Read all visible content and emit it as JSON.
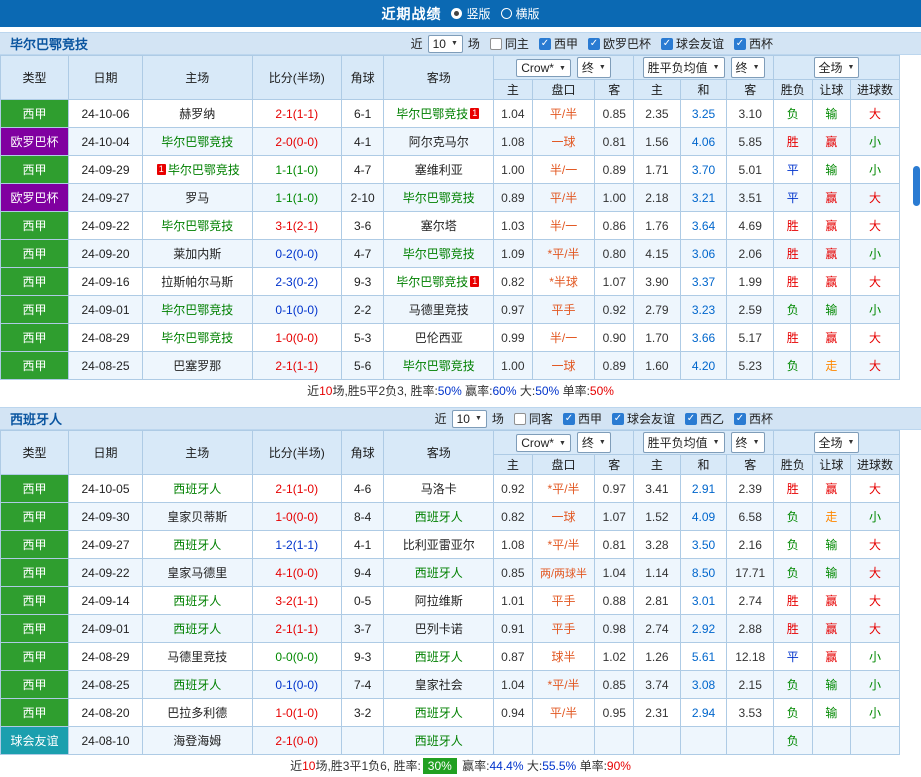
{
  "topbar": {
    "title": "近期战绩",
    "options": [
      {
        "label": "竖版",
        "selected": true
      },
      {
        "label": "横版",
        "selected": false
      }
    ]
  },
  "colors": {
    "topbar_bg": "#0b69b3",
    "section_bg": "#d3e4f4",
    "header_bg": "#d8e9f8",
    "grid_border": "#aecbe5",
    "row_stripe": "#eef6fd",
    "laliga_green": "#2f9e2f",
    "europa_purple": "#8000a0",
    "friendly_teal": "#1b9fae",
    "tracked_team_green": "#008000",
    "home_win_red": "#e60000",
    "draw_blue": "#0033cc",
    "away_win_blue": "#0033cc",
    "lose_green": "#008800",
    "push_orange": "#ff8800",
    "handicap_orange": "#e25822",
    "draw_odds_blue": "#0066cc",
    "summary_badge_green": "#21a021",
    "red_card_badge": "#e80000"
  },
  "table_header": {
    "cols": [
      "类型",
      "日期",
      "主场",
      "比分(半场)",
      "角球",
      "客场"
    ],
    "dd_company": "Crow*",
    "dd_final": "终",
    "dd_avg": "胜平负均值",
    "dd_scope": "全场",
    "sub_cols": [
      "主",
      "盘口",
      "客",
      "主",
      "和",
      "客",
      "胜负",
      "让球",
      "进球数"
    ]
  },
  "sections": [
    {
      "team": "毕尔巴鄂竞技",
      "filter": {
        "prefix": "近",
        "count": "10",
        "suffix": "场",
        "checks": [
          {
            "label": "同主",
            "checked": false
          },
          {
            "label": "西甲",
            "checked": true
          },
          {
            "label": "欧罗巴杯",
            "checked": true
          },
          {
            "label": "球会友谊",
            "checked": true
          },
          {
            "label": "西杯",
            "checked": true
          }
        ]
      },
      "rows": [
        {
          "league": "西甲",
          "date": "24-10-06",
          "home": {
            "name": "赫罗纳",
            "tracked": false
          },
          "score": "2-1(1-1)",
          "corner": "6-1",
          "away": {
            "name": "毕尔巴鄂竞技",
            "tracked": true,
            "badge": "1"
          },
          "odds": [
            "1.04",
            "平/半",
            "0.85",
            "2.35",
            "3.25",
            "3.10"
          ],
          "result": [
            "负",
            "输",
            "大"
          ]
        },
        {
          "league": "欧罗巴杯",
          "date": "24-10-04",
          "home": {
            "name": "毕尔巴鄂竞技",
            "tracked": true
          },
          "score": "2-0(0-0)",
          "corner": "4-1",
          "away": {
            "name": "阿尔克马尔",
            "tracked": false
          },
          "odds": [
            "1.08",
            "一球",
            "0.81",
            "1.56",
            "4.06",
            "5.85"
          ],
          "result": [
            "胜",
            "赢",
            "小"
          ]
        },
        {
          "league": "西甲",
          "date": "24-09-29",
          "home": {
            "name": "毕尔巴鄂竞技",
            "tracked": true,
            "badge": "1"
          },
          "score": "1-1(1-0)",
          "corner": "4-7",
          "away": {
            "name": "塞维利亚",
            "tracked": false
          },
          "odds": [
            "1.00",
            "半/一",
            "0.89",
            "1.71",
            "3.70",
            "5.01"
          ],
          "result": [
            "平",
            "输",
            "小"
          ]
        },
        {
          "league": "欧罗巴杯",
          "date": "24-09-27",
          "home": {
            "name": "罗马",
            "tracked": false
          },
          "score": "1-1(1-0)",
          "corner": "2-10",
          "away": {
            "name": "毕尔巴鄂竞技",
            "tracked": true
          },
          "odds": [
            "0.89",
            "平/半",
            "1.00",
            "2.18",
            "3.21",
            "3.51"
          ],
          "result": [
            "平",
            "赢",
            "大"
          ]
        },
        {
          "league": "西甲",
          "date": "24-09-22",
          "home": {
            "name": "毕尔巴鄂竞技",
            "tracked": true
          },
          "score": "3-1(2-1)",
          "corner": "3-6",
          "away": {
            "name": "塞尔塔",
            "tracked": false
          },
          "odds": [
            "1.03",
            "半/一",
            "0.86",
            "1.76",
            "3.64",
            "4.69"
          ],
          "result": [
            "胜",
            "赢",
            "大"
          ]
        },
        {
          "league": "西甲",
          "date": "24-09-20",
          "home": {
            "name": "莱加内斯",
            "tracked": false
          },
          "score": "0-2(0-0)",
          "corner": "4-7",
          "away": {
            "name": "毕尔巴鄂竞技",
            "tracked": true
          },
          "odds": [
            "1.09",
            "*平/半",
            "0.80",
            "4.15",
            "3.06",
            "2.06"
          ],
          "result": [
            "胜",
            "赢",
            "小"
          ]
        },
        {
          "league": "西甲",
          "date": "24-09-16",
          "home": {
            "name": "拉斯帕尔马斯",
            "tracked": false
          },
          "score": "2-3(0-2)",
          "corner": "9-3",
          "away": {
            "name": "毕尔巴鄂竞技",
            "tracked": true,
            "badge": "1"
          },
          "odds": [
            "0.82",
            "*半球",
            "1.07",
            "3.90",
            "3.37",
            "1.99"
          ],
          "result": [
            "胜",
            "赢",
            "大"
          ]
        },
        {
          "league": "西甲",
          "date": "24-09-01",
          "home": {
            "name": "毕尔巴鄂竞技",
            "tracked": true
          },
          "score": "0-1(0-0)",
          "corner": "2-2",
          "away": {
            "name": "马德里竞技",
            "tracked": false
          },
          "odds": [
            "0.97",
            "平手",
            "0.92",
            "2.79",
            "3.23",
            "2.59"
          ],
          "result": [
            "负",
            "输",
            "小"
          ]
        },
        {
          "league": "西甲",
          "date": "24-08-29",
          "home": {
            "name": "毕尔巴鄂竞技",
            "tracked": true
          },
          "score": "1-0(0-0)",
          "corner": "5-3",
          "away": {
            "name": "巴伦西亚",
            "tracked": false
          },
          "odds": [
            "0.99",
            "半/一",
            "0.90",
            "1.70",
            "3.66",
            "5.17"
          ],
          "result": [
            "胜",
            "赢",
            "大"
          ]
        },
        {
          "league": "西甲",
          "date": "24-08-25",
          "home": {
            "name": "巴塞罗那",
            "tracked": false
          },
          "score": "2-1(1-1)",
          "corner": "5-6",
          "away": {
            "name": "毕尔巴鄂竞技",
            "tracked": true
          },
          "odds": [
            "1.00",
            "一球",
            "0.89",
            "1.60",
            "4.20",
            "5.23"
          ],
          "result": [
            "负",
            "走",
            "大"
          ]
        }
      ],
      "summary": [
        {
          "t": "近"
        },
        {
          "t": "10",
          "c": "red"
        },
        {
          "t": "场,胜5平2负3, 胜率:"
        },
        {
          "t": "50%",
          "c": "blue"
        },
        {
          "t": " 赢率:"
        },
        {
          "t": "60%",
          "c": "blue"
        },
        {
          "t": " 大:"
        },
        {
          "t": "50%",
          "c": "blue"
        },
        {
          "t": " 单率:"
        },
        {
          "t": "50%",
          "c": "red"
        }
      ]
    },
    {
      "team": "西班牙人",
      "filter": {
        "prefix": "近",
        "count": "10",
        "suffix": "场",
        "checks": [
          {
            "label": "同客",
            "checked": false
          },
          {
            "label": "西甲",
            "checked": true
          },
          {
            "label": "球会友谊",
            "checked": true
          },
          {
            "label": "西乙",
            "checked": true
          },
          {
            "label": "西杯",
            "checked": true
          }
        ]
      },
      "rows": [
        {
          "league": "西甲",
          "date": "24-10-05",
          "home": {
            "name": "西班牙人",
            "tracked": true
          },
          "score": "2-1(1-0)",
          "corner": "4-6",
          "away": {
            "name": "马洛卡",
            "tracked": false
          },
          "odds": [
            "0.92",
            "*平/半",
            "0.97",
            "3.41",
            "2.91",
            "2.39"
          ],
          "result": [
            "胜",
            "赢",
            "大"
          ]
        },
        {
          "league": "西甲",
          "date": "24-09-30",
          "home": {
            "name": "皇家贝蒂斯",
            "tracked": false
          },
          "score": "1-0(0-0)",
          "corner": "8-4",
          "away": {
            "name": "西班牙人",
            "tracked": true
          },
          "odds": [
            "0.82",
            "一球",
            "1.07",
            "1.52",
            "4.09",
            "6.58"
          ],
          "result": [
            "负",
            "走",
            "小"
          ]
        },
        {
          "league": "西甲",
          "date": "24-09-27",
          "home": {
            "name": "西班牙人",
            "tracked": true
          },
          "score": "1-2(1-1)",
          "corner": "4-1",
          "away": {
            "name": "比利亚雷亚尔",
            "tracked": false
          },
          "odds": [
            "1.08",
            "*平/半",
            "0.81",
            "3.28",
            "3.50",
            "2.16"
          ],
          "result": [
            "负",
            "输",
            "大"
          ]
        },
        {
          "league": "西甲",
          "date": "24-09-22",
          "home": {
            "name": "皇家马德里",
            "tracked": false
          },
          "score": "4-1(0-0)",
          "corner": "9-4",
          "away": {
            "name": "西班牙人",
            "tracked": true
          },
          "odds": [
            "0.85",
            "两/两球半",
            "1.04",
            "1.14",
            "8.50",
            "17.71"
          ],
          "result": [
            "负",
            "输",
            "大"
          ]
        },
        {
          "league": "西甲",
          "date": "24-09-14",
          "home": {
            "name": "西班牙人",
            "tracked": true
          },
          "score": "3-2(1-1)",
          "corner": "0-5",
          "away": {
            "name": "阿拉维斯",
            "tracked": false
          },
          "odds": [
            "1.01",
            "平手",
            "0.88",
            "2.81",
            "3.01",
            "2.74"
          ],
          "result": [
            "胜",
            "赢",
            "大"
          ]
        },
        {
          "league": "西甲",
          "date": "24-09-01",
          "home": {
            "name": "西班牙人",
            "tracked": true
          },
          "score": "2-1(1-1)",
          "corner": "3-7",
          "away": {
            "name": "巴列卡诺",
            "tracked": false
          },
          "odds": [
            "0.91",
            "平手",
            "0.98",
            "2.74",
            "2.92",
            "2.88"
          ],
          "result": [
            "胜",
            "赢",
            "大"
          ]
        },
        {
          "league": "西甲",
          "date": "24-08-29",
          "home": {
            "name": "马德里竞技",
            "tracked": false
          },
          "score": "0-0(0-0)",
          "corner": "9-3",
          "away": {
            "name": "西班牙人",
            "tracked": true
          },
          "odds": [
            "0.87",
            "球半",
            "1.02",
            "1.26",
            "5.61",
            "12.18"
          ],
          "result": [
            "平",
            "赢",
            "小"
          ]
        },
        {
          "league": "西甲",
          "date": "24-08-25",
          "home": {
            "name": "西班牙人",
            "tracked": true
          },
          "score": "0-1(0-0)",
          "corner": "7-4",
          "away": {
            "name": "皇家社会",
            "tracked": false
          },
          "odds": [
            "1.04",
            "*平/半",
            "0.85",
            "3.74",
            "3.08",
            "2.15"
          ],
          "result": [
            "负",
            "输",
            "小"
          ]
        },
        {
          "league": "西甲",
          "date": "24-08-20",
          "home": {
            "name": "巴拉多利德",
            "tracked": false
          },
          "score": "1-0(1-0)",
          "corner": "3-2",
          "away": {
            "name": "西班牙人",
            "tracked": true
          },
          "odds": [
            "0.94",
            "平/半",
            "0.95",
            "2.31",
            "2.94",
            "3.53"
          ],
          "result": [
            "负",
            "输",
            "小"
          ]
        },
        {
          "league": "球会友谊",
          "date": "24-08-10",
          "home": {
            "name": "海登海姆",
            "tracked": false
          },
          "score": "2-1(0-0)",
          "corner": "",
          "away": {
            "name": "西班牙人",
            "tracked": true
          },
          "odds": [
            "",
            "",
            "",
            "",
            "",
            ""
          ],
          "result": [
            "负",
            "",
            ""
          ]
        }
      ],
      "summary": [
        {
          "t": "近"
        },
        {
          "t": "10",
          "c": "red"
        },
        {
          "t": "场,胜3平1负6, 胜率:"
        },
        {
          "t": "30%",
          "c": "badge"
        },
        {
          "t": " 赢率:"
        },
        {
          "t": "44.4%",
          "c": "blue"
        },
        {
          "t": " 大:"
        },
        {
          "t": "55.5%",
          "c": "blue"
        },
        {
          "t": " 单率:"
        },
        {
          "t": "90%",
          "c": "red"
        }
      ]
    }
  ]
}
